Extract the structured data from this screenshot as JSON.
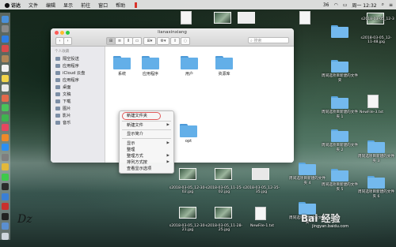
{
  "menubar": {
    "app": "访达",
    "items": [
      "文件",
      "编辑",
      "显示",
      "前往",
      "窗口",
      "帮助"
    ],
    "status_items": [
      "36",
      "周一 12:32"
    ]
  },
  "window": {
    "title": "lianaxinxiang",
    "search_placeholder": "搜索"
  },
  "sidebar": {
    "sections": [
      {
        "header": "个人收藏",
        "items": [
          "隔空投送",
          "应用程序",
          "iCloud 云盘",
          "应用程序",
          "桌面",
          "文稿",
          "下载",
          "图片",
          "影片",
          "音乐"
        ]
      }
    ]
  },
  "content": {
    "folders": [
      "系统",
      "应用程序",
      "用户",
      "资源库",
      "opt"
    ]
  },
  "context_menu": {
    "items": [
      "新建文件夹",
      "新建文件",
      "显示简介",
      "显示",
      "整理",
      "整理方式",
      "排列方式按",
      "查看显示选项"
    ],
    "submenu_flags": [
      false,
      true,
      false,
      true,
      true,
      true,
      true,
      false
    ]
  },
  "desktop": {
    "labels": [
      "s2018-03-05_12-11-48.jpg",
      "s2018-03-05_12-3",
      "周间选项目新建的文件夹",
      "周同选项目新建的文件夹 1",
      "NewFile-3.txt",
      "周间选项目新建的文件夹 2",
      "周同选项目新建的文件夹 3",
      "周间选项目新建的文件夹 4",
      "周间选项目新建的文件夹 5",
      "周同选项目新建的文件夹 6",
      "s2018-03-05_12-30-02.jpg",
      "s2018-03-05_11-25-02.jpg",
      "s2018-03-05_12-35-35.jpg",
      "s2018-03-05_12-30-21.jpg",
      "s2018-03-05_11-28-25.jpg",
      "NewFile-1.txt",
      "周同选项目新建的文件夹"
    ]
  },
  "watermark": {
    "text": "Bai 经验",
    "sub": "jingyan.baidu.com"
  }
}
